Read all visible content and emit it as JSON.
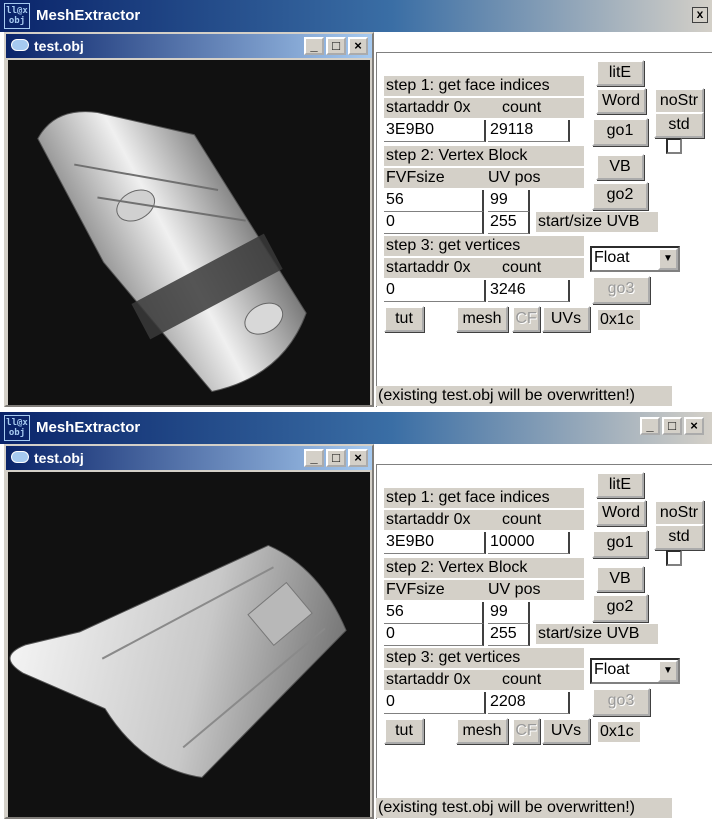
{
  "windows": [
    {
      "app_title": "MeshExtractor",
      "app_icon_text": "ll@x obj",
      "child_title": "test.obj",
      "step1": {
        "label": "step 1: get face indices",
        "startaddr_label": "startaddr 0x",
        "count_label": "count",
        "startaddr": "3E9B0",
        "count": "29118"
      },
      "step2": {
        "label": "step 2: Vertex Block",
        "fvf_label": "FVFsize",
        "uvpos_label": "UV pos",
        "fvfsize": "56",
        "uvpos": "99",
        "start_uvb": "0",
        "size_uvb": "255",
        "uvb_label": "start/size UVB"
      },
      "step3": {
        "label": "step 3: get vertices",
        "startaddr_label": "startaddr 0x",
        "count_label": "count",
        "startaddr": "0",
        "count": "3246"
      },
      "buttons": {
        "litE": "litE",
        "word": "Word",
        "nostr": "noStr",
        "std": "std",
        "go1": "go1",
        "vb": "VB",
        "go2": "go2",
        "go3": "go3",
        "tut": "tut",
        "mesh": "mesh",
        "cf": "CF",
        "uvs": "UVs"
      },
      "float_select": "Float",
      "offset_label": "0x1c",
      "warning": "(existing test.obj will be overwritten!)"
    },
    {
      "app_title": "MeshExtractor",
      "app_icon_text": "ll@x obj",
      "child_title": "test.obj",
      "step1": {
        "label": "step 1: get face indices",
        "startaddr_label": "startaddr 0x",
        "count_label": "count",
        "startaddr": "3E9B0",
        "count": "10000"
      },
      "step2": {
        "label": "step 2: Vertex Block",
        "fvf_label": "FVFsize",
        "uvpos_label": "UV pos",
        "fvfsize": "56",
        "uvpos": "99",
        "start_uvb": "0",
        "size_uvb": "255",
        "uvb_label": "start/size UVB"
      },
      "step3": {
        "label": "step 3: get vertices",
        "startaddr_label": "startaddr 0x",
        "count_label": "count",
        "startaddr": "0",
        "count": "2208"
      },
      "buttons": {
        "litE": "litE",
        "word": "Word",
        "nostr": "noStr",
        "std": "std",
        "go1": "go1",
        "vb": "VB",
        "go2": "go2",
        "go3": "go3",
        "tut": "tut",
        "mesh": "mesh",
        "cf": "CF",
        "uvs": "UVs"
      },
      "float_select": "Float",
      "offset_label": "0x1c",
      "warning": "(existing test.obj will be overwritten!)"
    }
  ],
  "window_controls": {
    "close": "x",
    "min": "_",
    "max": "□",
    "x": "×"
  },
  "colors": {
    "titlebar_start": "#0a246a",
    "titlebar_end": "#a6caf0",
    "face": "#d4d0c8",
    "viewport_bg": "#111111",
    "mesh_light": "#e8e8e8",
    "mesh_dark": "#3a3a3a"
  }
}
